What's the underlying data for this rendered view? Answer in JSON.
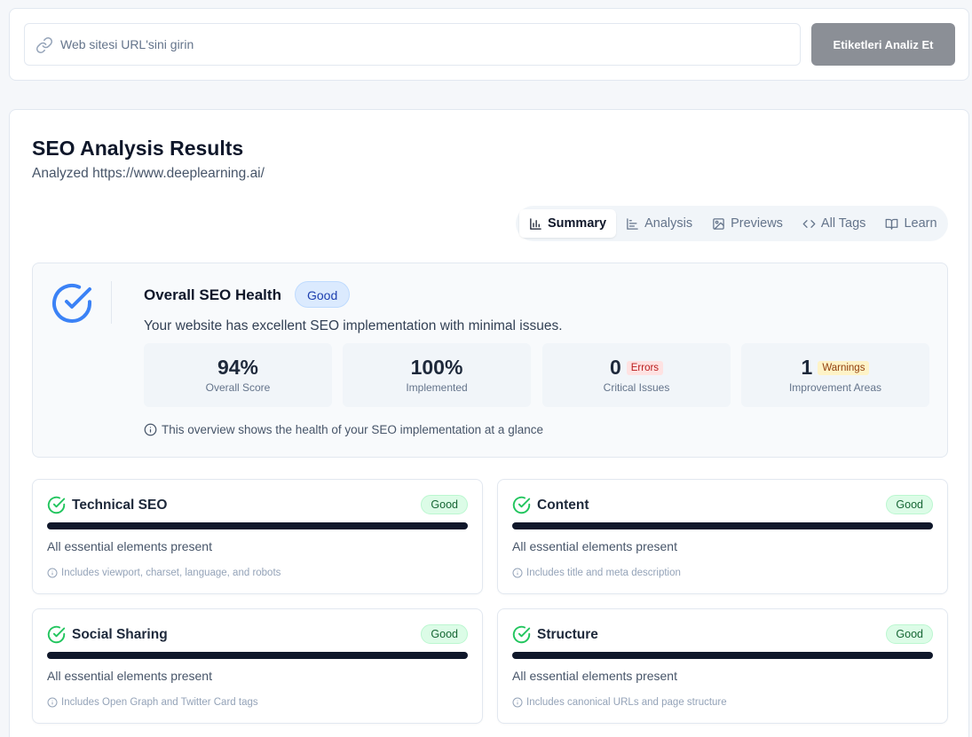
{
  "search": {
    "placeholder": "Web sitesi URL'sini girin",
    "value": "",
    "button_label": "Etiketleri Analiz Et"
  },
  "results": {
    "title": "SEO Analysis Results",
    "subtitle": "Analyzed https://www.deeplearning.ai/",
    "tabs": [
      {
        "label": "Summary",
        "icon": "bar-chart-icon",
        "active": true
      },
      {
        "label": "Analysis",
        "icon": "line-chart-icon",
        "active": false
      },
      {
        "label": "Previews",
        "icon": "image-icon",
        "active": false
      },
      {
        "label": "All Tags",
        "icon": "code-icon",
        "active": false
      },
      {
        "label": "Learn",
        "icon": "book-open-icon",
        "active": false
      }
    ]
  },
  "health": {
    "title": "Overall SEO Health",
    "badge": "Good",
    "description": "Your website has excellent SEO implementation with minimal issues.",
    "stats": [
      {
        "value": "94%",
        "label": "Overall Score",
        "tag": ""
      },
      {
        "value": "100%",
        "label": "Implemented",
        "tag": ""
      },
      {
        "value": "0",
        "label": "Critical Issues",
        "tag": "Errors"
      },
      {
        "value": "1",
        "label": "Improvement Areas",
        "tag": "Warnings"
      }
    ],
    "note": "This overview shows the health of your SEO implementation at a glance"
  },
  "categories": [
    {
      "title": "Technical SEO",
      "badge": "Good",
      "progress": 1.0,
      "status": "All essential elements present",
      "note": "Includes viewport, charset, language, and robots"
    },
    {
      "title": "Content",
      "badge": "Good",
      "progress": 1.0,
      "status": "All essential elements present",
      "note": "Includes title and meta description"
    },
    {
      "title": "Social Sharing",
      "badge": "Good",
      "progress": 1.0,
      "status": "All essential elements present",
      "note": "Includes Open Graph and Twitter Card tags"
    },
    {
      "title": "Structure",
      "badge": "Good",
      "progress": 1.0,
      "status": "All essential elements present",
      "note": "Includes canonical URLs and page structure"
    }
  ],
  "colors": {
    "accent_blue": "#3b82f6",
    "good_green": "#22c55e",
    "progress_fill": "#0f172a"
  }
}
